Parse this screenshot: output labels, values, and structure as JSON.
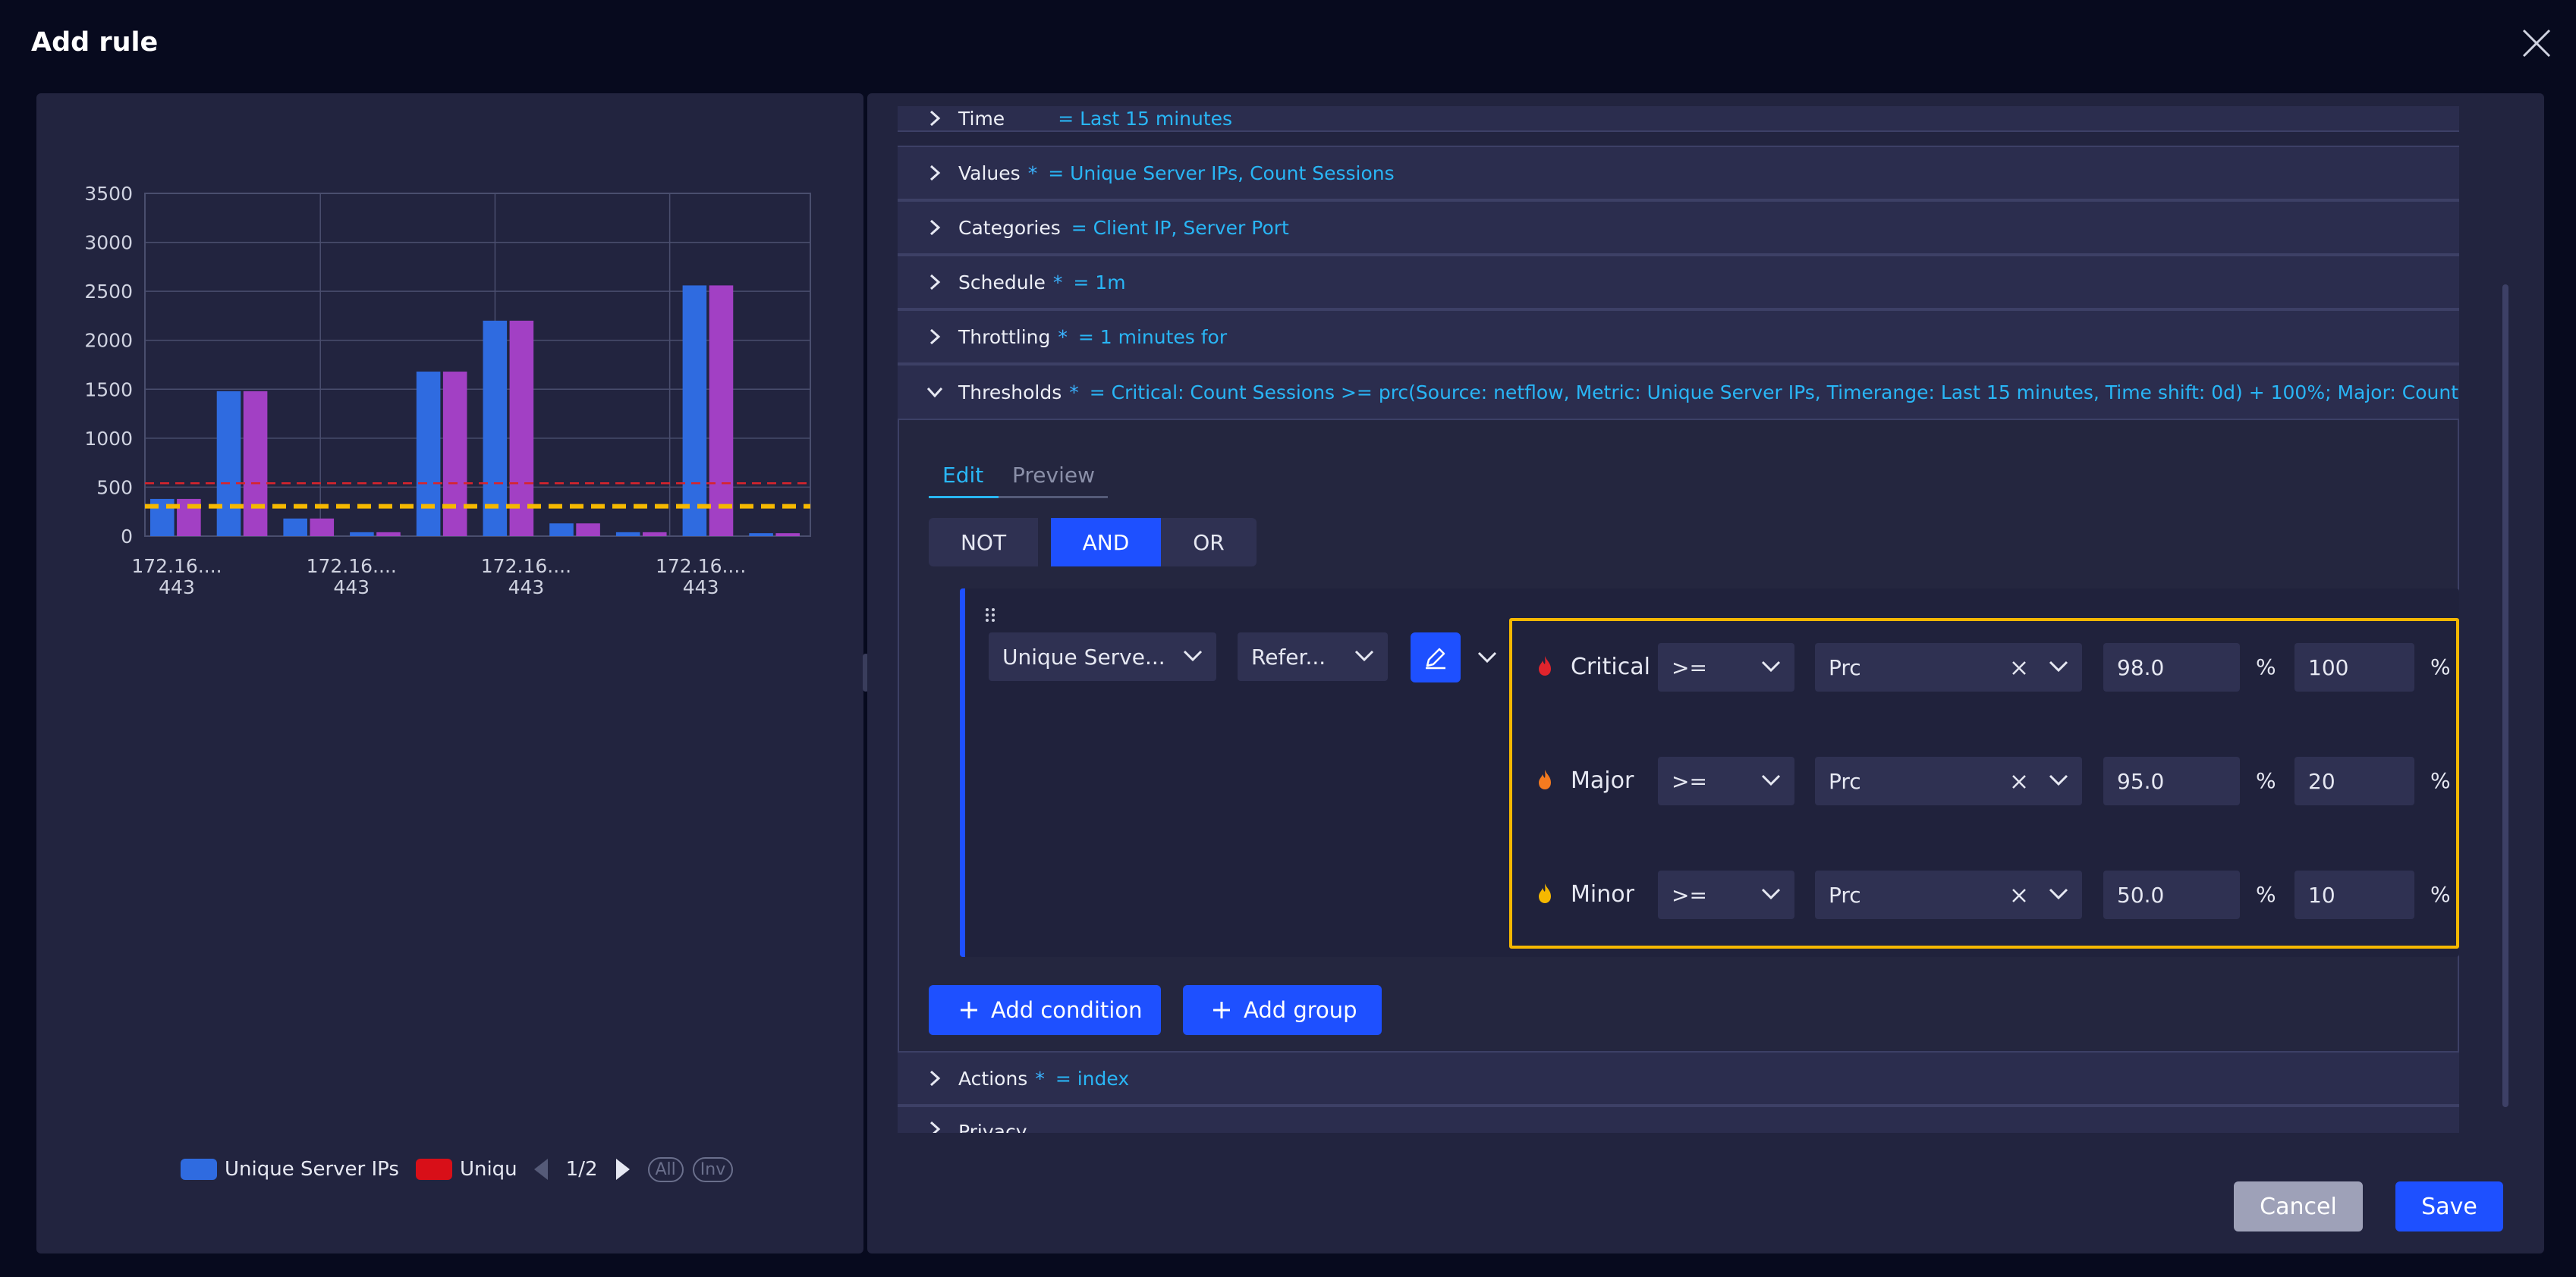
{
  "dialog": {
    "title": "Add rule"
  },
  "chart_data": {
    "type": "bar",
    "y_ticks": [
      "3500",
      "3000",
      "2500",
      "2000",
      "1500",
      "1000",
      "500",
      "0"
    ],
    "ylim": [
      0,
      3500
    ],
    "x_tick_labels": [
      {
        "line1": "172.16....",
        "line2": "443"
      },
      {
        "line1": "172.16....",
        "line2": "443"
      },
      {
        "line1": "172.16....",
        "line2": "443"
      },
      {
        "line1": "172.16....",
        "line2": "443"
      }
    ],
    "series": [
      {
        "color": "#2f6be0",
        "values": [
          380,
          1480,
          180,
          40,
          1680,
          2200,
          130,
          40,
          2560,
          30
        ]
      },
      {
        "color": "#a240c4",
        "values": [
          380,
          1480,
          180,
          40,
          1680,
          2200,
          130,
          40,
          2560,
          30
        ]
      }
    ],
    "threshold_lines": [
      {
        "value": 540,
        "color": "#d8242c",
        "style": "dashed-thin"
      },
      {
        "value": 305,
        "color": "#f5b800",
        "style": "dashed-thick"
      }
    ],
    "grid": true,
    "legend": {
      "placement": "bottom",
      "items": [
        {
          "label": "Unique Server IPs",
          "color": "#2f6be0"
        },
        {
          "label": "Uniqu",
          "color": "#d80f18"
        }
      ],
      "page": "1/2",
      "all_label": "All",
      "inv_label": "Inv"
    }
  },
  "sections": {
    "time": {
      "name": "Time",
      "value": "= Last 15 minutes"
    },
    "values": {
      "name": "Values",
      "required": "*",
      "value": "= Unique Server IPs, Count Sessions"
    },
    "categories": {
      "name": "Categories",
      "value": "= Client IP, Server Port"
    },
    "schedule": {
      "name": "Schedule",
      "required": "*",
      "value": "= 1m"
    },
    "throttling": {
      "name": "Throttling",
      "required": "*",
      "value": "= 1 minutes for"
    },
    "thresholds": {
      "name": "Thresholds",
      "required": "*",
      "value": "= Critical: Count Sessions >= prc(Source: netflow, Metric: Unique Server IPs, Timerange: Last 15 minutes, Time shift: 0d) + 100%; Major: Count Sessions >=..."
    },
    "actions": {
      "name": "Actions",
      "required": "*",
      "value": "= index"
    },
    "privacy": {
      "name": "Privacy"
    }
  },
  "tabs": {
    "edit": "Edit",
    "preview": "Preview"
  },
  "logic": {
    "not": "NOT",
    "and": "AND",
    "or": "OR"
  },
  "condition": {
    "metric_select": "Unique Serve...",
    "reference_select": "Refer...",
    "rows": [
      {
        "label": "Critical",
        "operator": ">=",
        "function": "Prc",
        "value": "98.0",
        "unit1": "%",
        "extra": "100",
        "unit2": "%",
        "flame_color": "#e0242c"
      },
      {
        "label": "Major",
        "operator": ">=",
        "function": "Prc",
        "value": "95.0",
        "unit1": "%",
        "extra": "20",
        "unit2": "%",
        "flame_color": "#f47a1f"
      },
      {
        "label": "Minor",
        "operator": ">=",
        "function": "Prc",
        "value": "50.0",
        "unit1": "%",
        "extra": "10",
        "unit2": "%",
        "flame_color": "#f5b800"
      }
    ]
  },
  "buttons": {
    "add_condition": "Add condition",
    "add_group": "Add group",
    "cancel": "Cancel",
    "save": "Save"
  },
  "colors": {
    "accent": "#1e50ff",
    "highlight": "#f5b800",
    "link": "#29b6f6"
  }
}
